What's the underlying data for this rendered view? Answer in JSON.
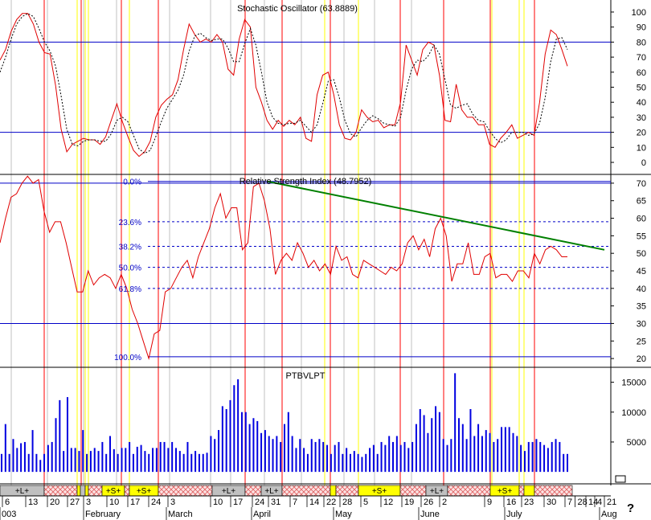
{
  "colors": {
    "background": "#ffffff",
    "price_red": "#e00000",
    "signal_black": "#000000",
    "level_blue": "#0000c8",
    "volume_blue": "#0000e0",
    "trend_green": "#008000",
    "cycle_red": "#ff0000",
    "cycle_yellow": "#ffff00",
    "cycle_gray": "#c0c0c0",
    "band_hatch": "#e06060",
    "band_gray": "#c0c0c0",
    "band_yellow": "#ffff00"
  },
  "x_axis": {
    "day_labels": [
      "6",
      "13",
      "20",
      "27",
      "3",
      "10",
      "17",
      "24",
      "3",
      "10",
      "17",
      "24",
      "31",
      "7",
      "14",
      "22",
      "28",
      "5",
      "12",
      "19",
      "26",
      "2",
      "9",
      "16",
      "23",
      "30",
      "7",
      "14",
      "21",
      "28",
      "4"
    ],
    "month_labels": [
      "003",
      "February",
      "March",
      "April",
      "May",
      "June",
      "July",
      "Aug"
    ]
  },
  "chart_data": [
    {
      "type": "line",
      "title": "Stochastic Oscillator (63.8889)",
      "ylim": [
        -8,
        108
      ],
      "yticks": [
        0,
        10,
        20,
        30,
        40,
        50,
        60,
        70,
        80,
        90,
        100
      ],
      "reference_levels": [
        20,
        80
      ],
      "series": [
        {
          "name": "%K",
          "color": "#e00000",
          "dashed": false,
          "values": [
            68,
            75,
            87,
            95,
            99,
            99,
            92,
            80,
            73,
            72,
            51,
            22,
            7,
            12,
            14,
            16,
            15,
            15,
            12,
            17,
            28,
            39,
            27,
            17,
            8,
            4,
            7,
            14,
            30,
            38,
            42,
            45,
            55,
            75,
            92,
            85,
            80,
            82,
            80,
            85,
            80,
            62,
            58,
            82,
            95,
            90,
            50,
            40,
            28,
            22,
            28,
            24,
            28,
            25,
            30,
            16,
            14,
            45,
            58,
            60,
            45,
            25,
            16,
            15,
            20,
            35,
            30,
            27,
            28,
            23,
            25,
            25,
            40,
            78,
            68,
            58,
            75,
            80,
            78,
            58,
            28,
            27,
            52,
            35,
            30,
            30,
            25,
            25,
            12,
            10,
            16,
            20,
            25,
            16,
            18,
            20,
            18,
            40,
            72,
            88,
            85,
            75,
            64
          ]
        },
        {
          "name": "%D",
          "color": "#000000",
          "dashed": true,
          "values": [
            60,
            70,
            82,
            92,
            97,
            99,
            97,
            89,
            80,
            74,
            64,
            44,
            22,
            12,
            11,
            14,
            15,
            15,
            14,
            14,
            19,
            28,
            30,
            27,
            18,
            9,
            6,
            8,
            17,
            27,
            36,
            42,
            48,
            58,
            74,
            84,
            86,
            83,
            81,
            82,
            82,
            76,
            67,
            67,
            79,
            89,
            78,
            60,
            40,
            30,
            26,
            25,
            26,
            26,
            28,
            24,
            20,
            25,
            39,
            54,
            55,
            43,
            28,
            19,
            17,
            23,
            28,
            31,
            29,
            26,
            25,
            24,
            30,
            48,
            62,
            68,
            67,
            71,
            78,
            72,
            55,
            38,
            36,
            38,
            39,
            32,
            28,
            27,
            21,
            16,
            13,
            15,
            20,
            20,
            20,
            18,
            19,
            26,
            43,
            67,
            82,
            83,
            75
          ]
        }
      ]
    },
    {
      "type": "line",
      "title": "Relative Strength Index (48.7952)",
      "ylim": [
        17.5,
        72.5
      ],
      "yticks": [
        20,
        25,
        30,
        35,
        40,
        45,
        50,
        55,
        60,
        65,
        70
      ],
      "reference_levels": [
        30,
        70
      ],
      "series": [
        {
          "name": "RSI",
          "color": "#e00000",
          "values": [
            53,
            60,
            66,
            67,
            70,
            72,
            70,
            71,
            62,
            56,
            59,
            59,
            53,
            46,
            39,
            39,
            45,
            41,
            43,
            44,
            43,
            40,
            44,
            40,
            34,
            30,
            25,
            20,
            27,
            28,
            39,
            40,
            43,
            46,
            48,
            43,
            49,
            53,
            57,
            63,
            67,
            60,
            63,
            63,
            51,
            53,
            69,
            70,
            65,
            57,
            44,
            48,
            50,
            48,
            53,
            50,
            46,
            48,
            45,
            47,
            44,
            52,
            48,
            49,
            44,
            43,
            48,
            47,
            46,
            45,
            44,
            46,
            45,
            47,
            53,
            55,
            51,
            54,
            49,
            57,
            60,
            55,
            42,
            47,
            47,
            53,
            44,
            44,
            49,
            50,
            43,
            44,
            44,
            42,
            45,
            45,
            43,
            50,
            47,
            51,
            52,
            51,
            49,
            49
          ]
        }
      ],
      "fibonacci": [
        {
          "label": "0.0%",
          "value": 70.5
        },
        {
          "label": "23.6%",
          "value": 59
        },
        {
          "label": "38.2%",
          "value": 52
        },
        {
          "label": "50.0%",
          "value": 46
        },
        {
          "label": "61.8%",
          "value": 40
        },
        {
          "label": "100.0%",
          "value": 20.5
        }
      ],
      "trendline": {
        "color": "#008000",
        "from": {
          "x": 333,
          "value": 70.5
        },
        "to": {
          "x": 752,
          "value": 51
        }
      }
    },
    {
      "type": "bar",
      "title": "PTBVLPT",
      "ylim": [
        -2000,
        17500
      ],
      "yticks": [
        5000,
        10000,
        15000
      ],
      "series": [
        {
          "name": "Volume",
          "color": "#0000e0",
          "values": [
            3000,
            8000,
            3000,
            5500,
            4000,
            4800,
            5000,
            3000,
            7000,
            3000,
            2000,
            3000,
            4500,
            5000,
            9000,
            12000,
            3500,
            12500,
            4000,
            4000,
            3500,
            7000,
            3000,
            3500,
            4000,
            3500,
            5000,
            3000,
            6000,
            3800,
            3000,
            4000,
            4000,
            5000,
            3000,
            4200,
            4500,
            3500,
            3000,
            4000,
            4000,
            5000,
            5000,
            4000,
            5000,
            4000,
            3500,
            3000,
            5000,
            3000,
            3500,
            3000,
            3000,
            3200,
            6000,
            5500,
            7000,
            11000,
            10500,
            12000,
            14500,
            15500,
            10000,
            10000,
            8000,
            9000,
            8500,
            6500,
            7000,
            6000,
            5500,
            6000,
            5000,
            8000,
            10000,
            6000,
            4000,
            5500,
            4000,
            3000,
            5500,
            5000,
            5500,
            5000,
            4500,
            3000,
            4500,
            5000,
            3000,
            4000,
            3000,
            3500,
            3000,
            2500,
            3000,
            4000,
            4500,
            3000,
            5000,
            4500,
            6000,
            5000,
            6000,
            4500,
            5000,
            4000,
            5000,
            8000,
            10500,
            9500,
            6500,
            9000,
            11000,
            10000,
            5500,
            4500,
            5500,
            16500,
            9000,
            8000,
            5500,
            10500,
            6000,
            8000,
            6000,
            7000,
            6500,
            5000,
            5500,
            7500,
            7500,
            7500,
            6500,
            6000,
            4500,
            3500,
            5000,
            5000,
            5500,
            5000,
            4500,
            4000,
            5000,
            5500,
            5000,
            3000,
            3000
          ]
        }
      ]
    }
  ],
  "cycles": {
    "red_days": [
      55,
      101,
      151,
      197,
      305,
      351,
      411,
      498,
      552,
      610,
      665
    ],
    "yellow_days": [
      96,
      106,
      110,
      161,
      404,
      446,
      612,
      646,
      652
    ],
    "gray_days": [
      14,
      59,
      104,
      145,
      211,
      262,
      287,
      329,
      375,
      428,
      466,
      512
    ]
  },
  "bands": [
    {
      "start": 0,
      "end": 55,
      "style": "gray",
      "label": "+L+"
    },
    {
      "start": 55,
      "end": 96,
      "style": "hatch",
      "label": ""
    },
    {
      "start": 96,
      "end": 100,
      "style": "yellow",
      "label": ""
    },
    {
      "start": 100,
      "end": 106,
      "style": "gray",
      "label": ""
    },
    {
      "start": 106,
      "end": 110,
      "style": "yellow",
      "label": ""
    },
    {
      "start": 110,
      "end": 127,
      "style": "hatch",
      "label": ""
    },
    {
      "start": 127,
      "end": 155,
      "style": "yellow",
      "label": "+S+"
    },
    {
      "start": 155,
      "end": 161,
      "style": "hatch",
      "label": ""
    },
    {
      "start": 161,
      "end": 197,
      "style": "yellow",
      "label": "+S+"
    },
    {
      "start": 197,
      "end": 264,
      "style": "hatch",
      "label": ""
    },
    {
      "start": 264,
      "end": 305,
      "style": "gray",
      "label": "+L+"
    },
    {
      "start": 305,
      "end": 325,
      "style": "hatch",
      "label": ""
    },
    {
      "start": 325,
      "end": 351,
      "style": "gray",
      "label": "+L+"
    },
    {
      "start": 351,
      "end": 411,
      "style": "hatch",
      "label": ""
    },
    {
      "start": 411,
      "end": 418,
      "style": "yellow",
      "label": ""
    },
    {
      "start": 418,
      "end": 446,
      "style": "hatch",
      "label": ""
    },
    {
      "start": 446,
      "end": 498,
      "style": "yellow",
      "label": "+S+"
    },
    {
      "start": 498,
      "end": 530,
      "style": "hatch",
      "label": ""
    },
    {
      "start": 530,
      "end": 557,
      "style": "gray",
      "label": "+L+"
    },
    {
      "start": 557,
      "end": 610,
      "style": "hatch",
      "label": ""
    },
    {
      "start": 610,
      "end": 646,
      "style": "yellow",
      "label": "+S+"
    },
    {
      "start": 646,
      "end": 652,
      "style": "hatch",
      "label": ""
    },
    {
      "start": 652,
      "end": 665,
      "style": "yellow",
      "label": ""
    },
    {
      "start": 665,
      "end": 712,
      "style": "hatch",
      "label": ""
    }
  ],
  "footer": {
    "help_glyph": "?"
  }
}
